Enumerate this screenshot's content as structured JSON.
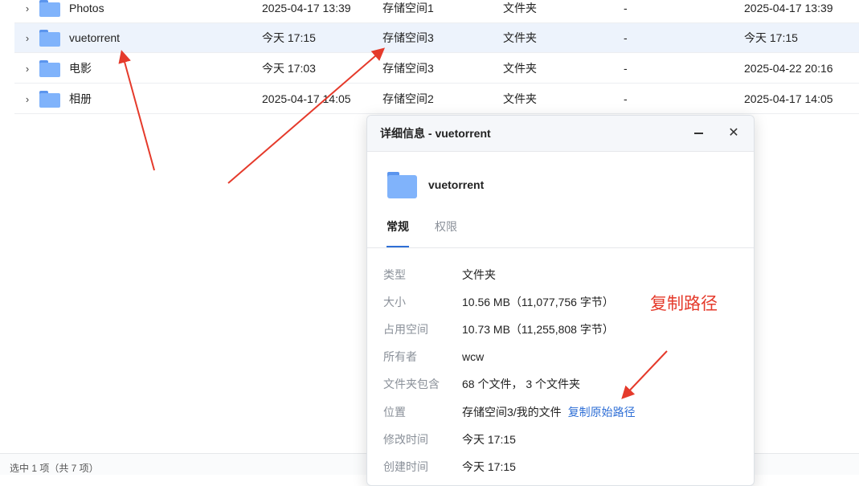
{
  "file_list": {
    "rows": [
      {
        "name": "Photos",
        "modified": "2025-04-17 13:39",
        "location": "存储空间1",
        "type": "文件夹",
        "size": "-",
        "modified2": "2025-04-17 13:39"
      },
      {
        "name": "vuetorrent",
        "modified": "今天 17:15",
        "location": "存储空间3",
        "type": "文件夹",
        "size": "-",
        "modified2": "今天 17:15"
      },
      {
        "name": "电影",
        "modified": "今天 17:03",
        "location": "存储空间3",
        "type": "文件夹",
        "size": "-",
        "modified2": "2025-04-22 20:16"
      },
      {
        "name": "相册",
        "modified": "2025-04-17 14:05",
        "location": "存储空间2",
        "type": "文件夹",
        "size": "-",
        "modified2": "2025-04-17 14:05"
      }
    ],
    "selected_index": 1
  },
  "status_bar": {
    "text": "选中 1 项（共 7 项）"
  },
  "dialog": {
    "title": "详细信息 - vuetorrent",
    "item_name": "vuetorrent",
    "tabs": [
      {
        "label": "常规",
        "active": true
      },
      {
        "label": "权限",
        "active": false
      }
    ],
    "properties": [
      {
        "key": "类型",
        "value": "文件夹"
      },
      {
        "key": "大小",
        "value": "10.56 MB（11,077,756 字节）"
      },
      {
        "key": "占用空间",
        "value": "10.73 MB（11,255,808 字节）"
      },
      {
        "key": "所有者",
        "value": "wcw"
      },
      {
        "key": "文件夹包含",
        "value": "68 个文件， 3 个文件夹"
      },
      {
        "key": "位置",
        "value": "存储空间3/我的文件",
        "link": "复制原始路径"
      },
      {
        "key": "修改时间",
        "value": "今天 17:15"
      },
      {
        "key": "创建时间",
        "value": "今天 17:15"
      }
    ]
  },
  "annotation": {
    "text": "复制路径",
    "color": "#e53a2b"
  },
  "colors": {
    "accent": "#2f6fd6",
    "folder": "#80b3fb",
    "selected_row": "#edf3fc"
  },
  "icons": {
    "expand": "chevron-right-icon",
    "folder": "folder-icon",
    "minimize": "minimize-icon",
    "close": "close-icon"
  }
}
